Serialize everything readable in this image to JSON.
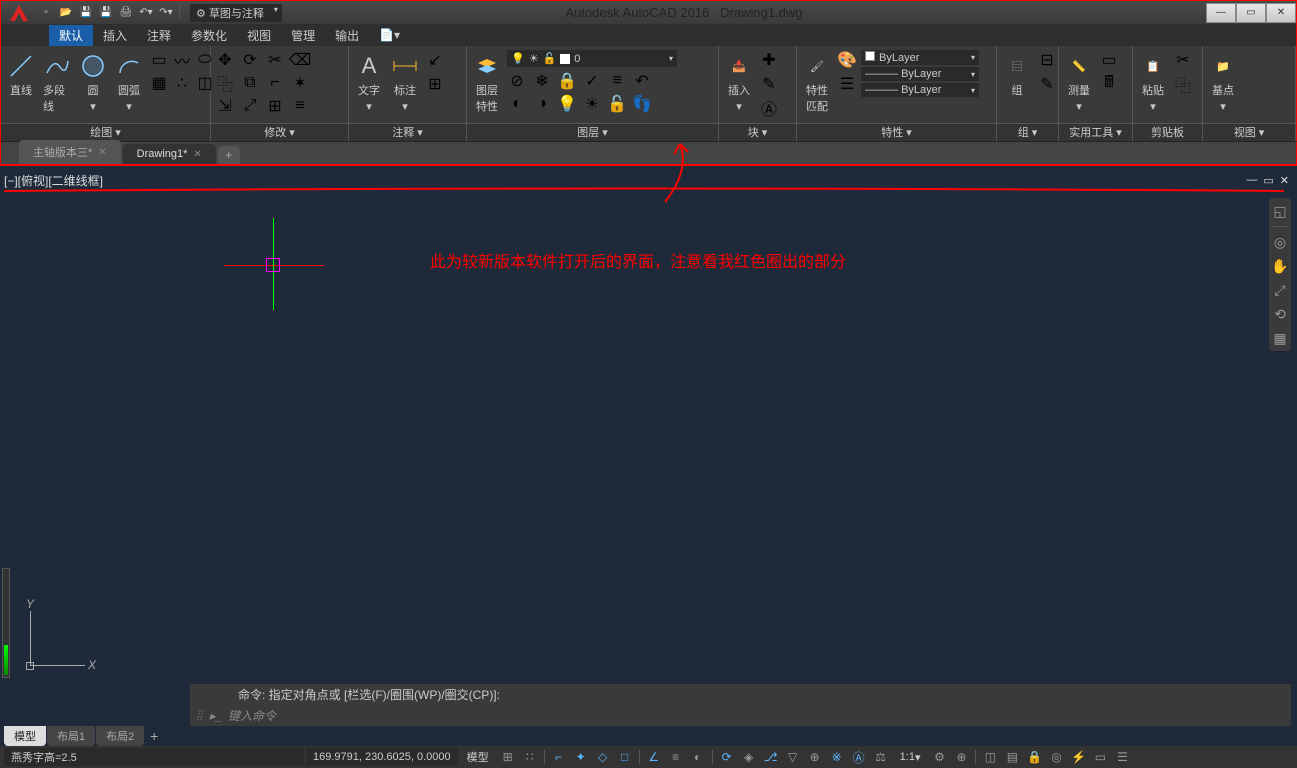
{
  "title": {
    "app": "Autodesk AutoCAD 2016",
    "file": "Drawing1.dwg"
  },
  "workspace": "草图与注释",
  "menus": [
    "默认",
    "插入",
    "注释",
    "参数化",
    "视图",
    "管理",
    "输出"
  ],
  "panels": {
    "draw": {
      "title": "绘图 ▾",
      "btns": [
        "直线",
        "多段线",
        "圆",
        "圆弧"
      ]
    },
    "modify": {
      "title": "修改 ▾"
    },
    "annotate": {
      "title": "注释 ▾",
      "btns": [
        "文字",
        "标注"
      ]
    },
    "layers": {
      "title": "图层 ▾",
      "btn": "图层\n特性",
      "dd": "0"
    },
    "block": {
      "title": "块 ▾",
      "btn": "插入"
    },
    "props": {
      "title": "特性 ▾",
      "btn": "特性\n匹配",
      "dd": "ByLayer"
    },
    "group": {
      "title": "组 ▾",
      "btn": "组"
    },
    "util": {
      "title": "实用工具 ▾",
      "btn": "测量"
    },
    "clip": {
      "title": "剪贴板",
      "btn": "粘贴"
    },
    "view": {
      "title": "视图 ▾",
      "btn": "基点"
    }
  },
  "file_tabs": [
    "主轴版本三*",
    "Drawing1*"
  ],
  "view_label": "[−][俯视][二维线框]",
  "annotation": "此为较新版本软件打开后的界面，注意看我红色圈出的部分",
  "cmd_hist": "命令: 指定对角点或 [栏选(F)/圈围(WP)/圈交(CP)]:",
  "cmd_prompt": "键入命令",
  "layout_tabs": [
    "模型",
    "布局1",
    "布局2"
  ],
  "status": {
    "style": "燕秀字高=2.5",
    "coords": "169.9791, 230.6025, 0.0000",
    "space": "模型",
    "scale": "1:1"
  },
  "axes": {
    "x": "X",
    "y": "Y"
  }
}
